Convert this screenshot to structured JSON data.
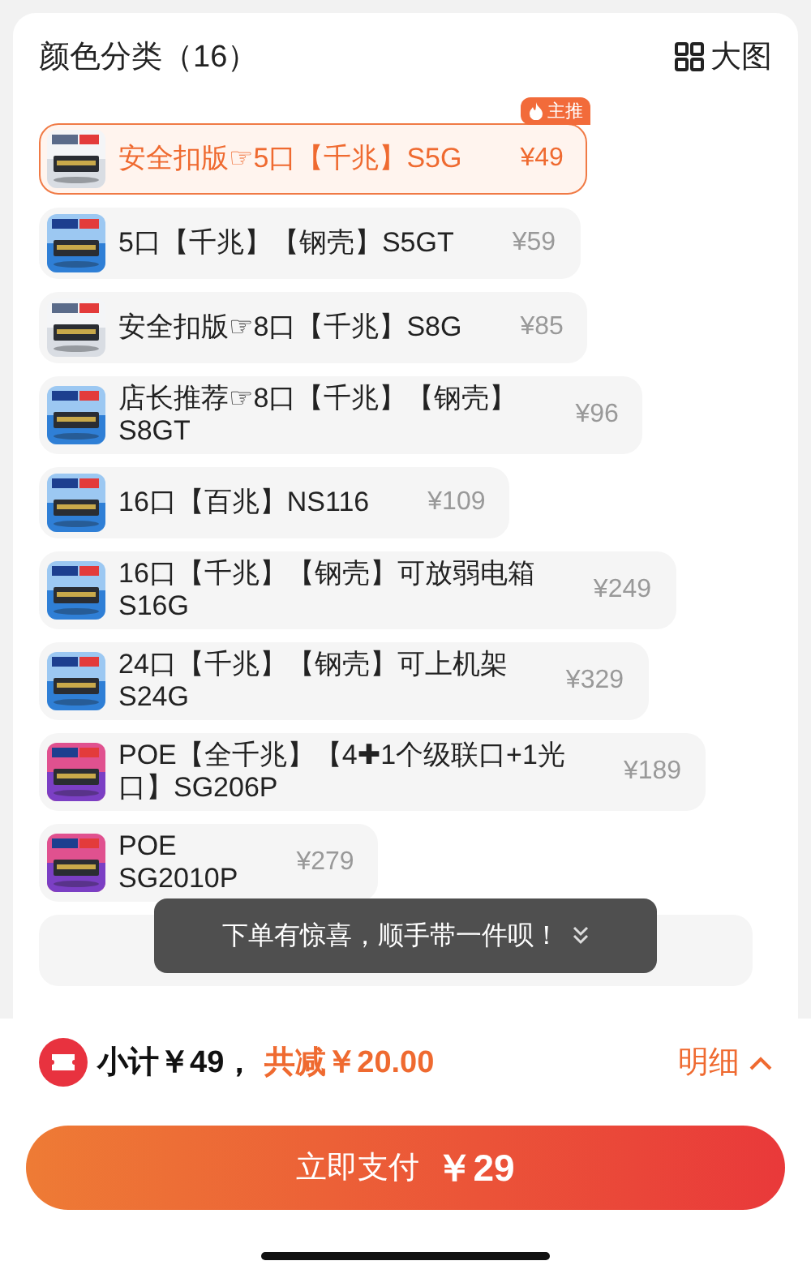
{
  "header": {
    "title": "颜色分类（16）",
    "view_toggle": "大图"
  },
  "options": [
    {
      "title_lines": [
        "安全扣版☞5口【千兆】S5G"
      ],
      "price": "¥49",
      "selected": true,
      "badge": "主推"
    },
    {
      "title_lines": [
        "5口【千兆】【钢壳】S5GT"
      ],
      "price": "¥59",
      "selected": false
    },
    {
      "title_lines": [
        "安全扣版☞8口【千兆】S8G"
      ],
      "price": "¥85",
      "selected": false
    },
    {
      "title_lines": [
        "店长推荐☞8口【千兆】【钢壳】",
        "S8GT"
      ],
      "price": "¥96",
      "selected": false
    },
    {
      "title_lines": [
        "16口【百兆】NS116"
      ],
      "price": "¥109",
      "selected": false
    },
    {
      "title_lines": [
        "16口【千兆】【钢壳】可放弱电箱",
        "S16G"
      ],
      "price": "¥249",
      "selected": false
    },
    {
      "title_lines": [
        "24口【千兆】【钢壳】可上机架",
        "S24G"
      ],
      "price": "¥329",
      "selected": false
    },
    {
      "title_lines": [
        "POE【全千兆】【4✚1个级联口+1光",
        "口】SG206P"
      ],
      "price": "¥189",
      "selected": false
    },
    {
      "title_lines": [
        "POE",
        "SG2010P"
      ],
      "price": "¥279",
      "selected": false
    }
  ],
  "toast": {
    "text": "下单有惊喜，顺手带一件呗！"
  },
  "summary": {
    "subtotal": "小计￥49，",
    "discount": "共减￥20.00",
    "details": "明细"
  },
  "pay_button": {
    "label": "立即支付",
    "amount": "￥29"
  }
}
